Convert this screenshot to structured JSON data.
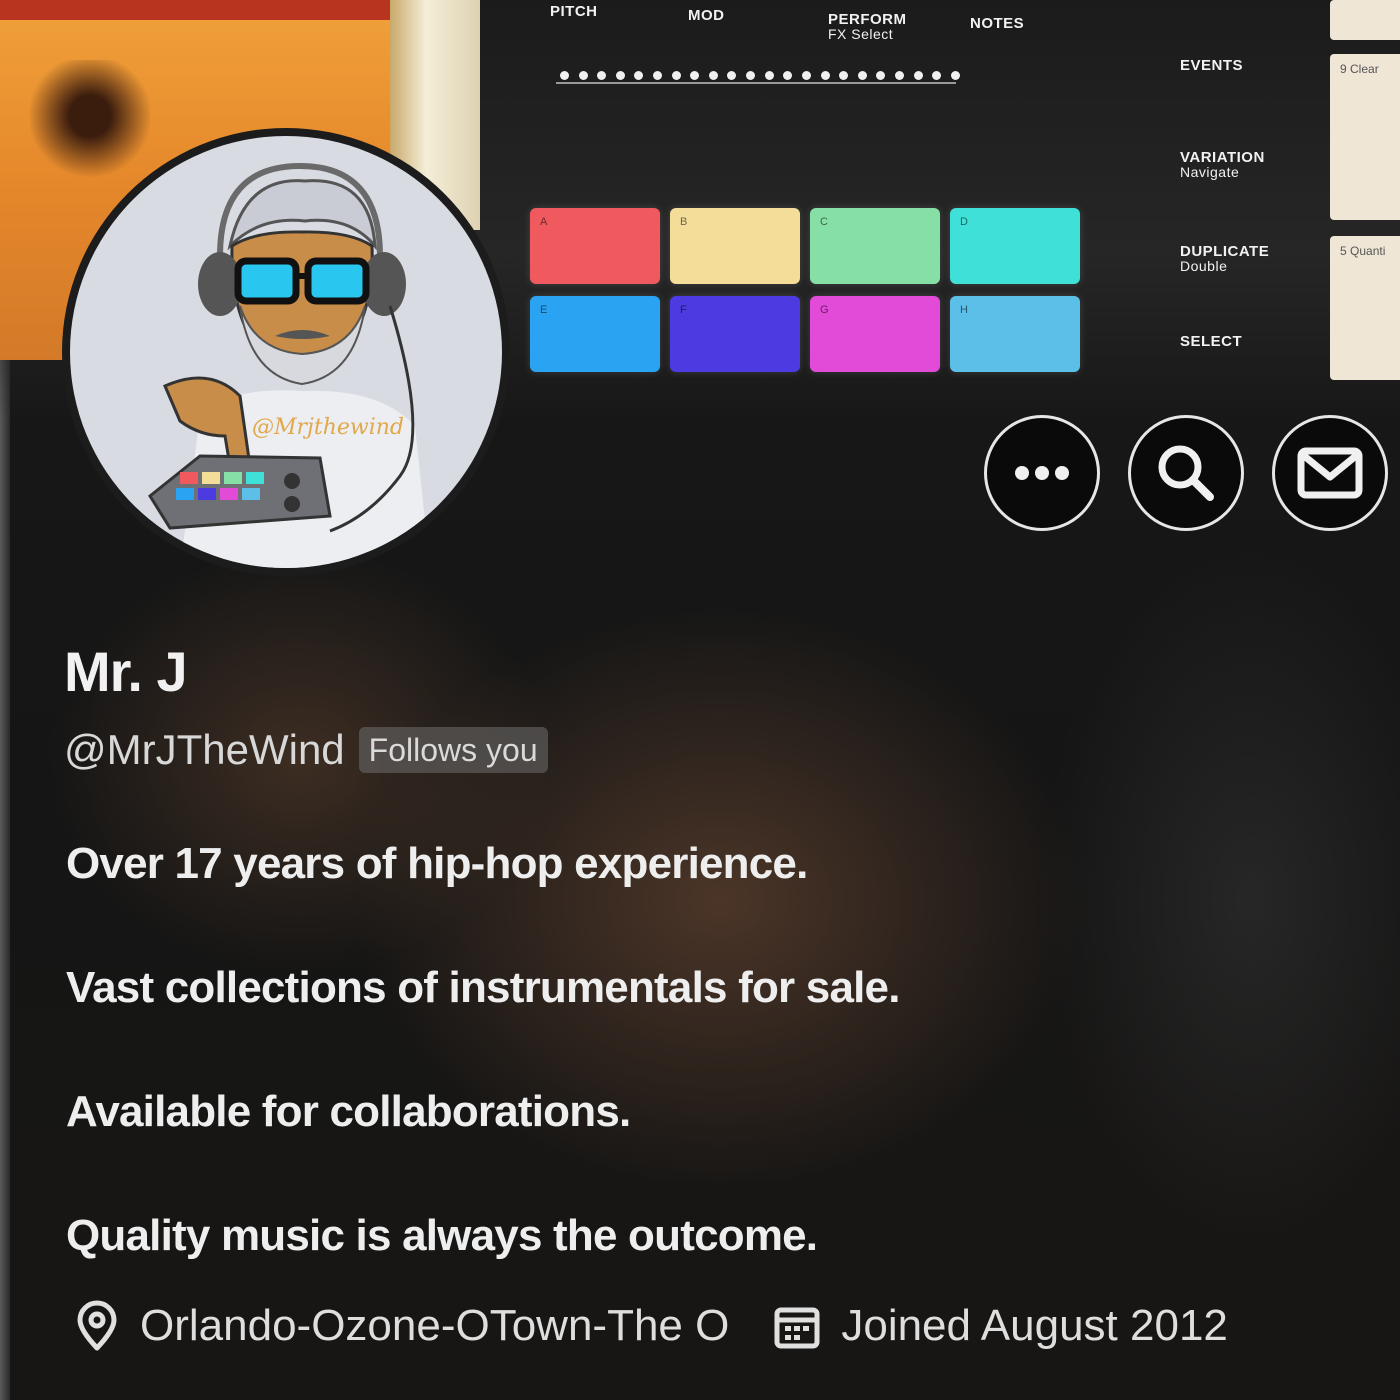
{
  "banner": {
    "param_labels": [
      {
        "label": "PITCH",
        "sub": ""
      },
      {
        "label": "MOD",
        "sub": ""
      },
      {
        "label": "PERFORM",
        "sub": "FX Select"
      },
      {
        "label": "NOTES",
        "sub": ""
      }
    ],
    "side_labels": [
      {
        "label": "EVENTS",
        "sub": ""
      },
      {
        "label": "VARIATION",
        "sub": "Navigate"
      },
      {
        "label": "DUPLICATE",
        "sub": "Double"
      },
      {
        "label": "SELECT",
        "sub": ""
      }
    ],
    "side_cards": [
      "9 Clear",
      "",
      "5 Quanti"
    ],
    "pads": [
      {
        "letter": "A",
        "color": "#f05a5e"
      },
      {
        "letter": "B",
        "color": "#f3dd98"
      },
      {
        "letter": "C",
        "color": "#86e0a6"
      },
      {
        "letter": "D",
        "color": "#3fe0d8"
      },
      {
        "letter": "E",
        "color": "#2aa4f2"
      },
      {
        "letter": "F",
        "color": "#4b3be0"
      },
      {
        "letter": "G",
        "color": "#e24ad8"
      },
      {
        "letter": "H",
        "color": "#5bbfe8"
      }
    ]
  },
  "avatar": {
    "signature": "@Mrjthewind"
  },
  "actions": {
    "more": "more-icon",
    "search": "search-icon",
    "message": "mail-icon"
  },
  "profile": {
    "display_name": "Mr. J",
    "handle": "@MrJTheWind",
    "follows_badge": "Follows you",
    "bio": [
      "Over 17 years of hip-hop experience.",
      "Vast collections of instrumentals for sale.",
      "Available for collaborations.",
      "Quality music is always the outcome."
    ],
    "location": "Orlando-Ozone-OTown-The O",
    "joined": "Joined August 2012"
  },
  "colors": {
    "background": "#121212",
    "text": "#eeeeee",
    "badge": "#6e6e6e"
  }
}
